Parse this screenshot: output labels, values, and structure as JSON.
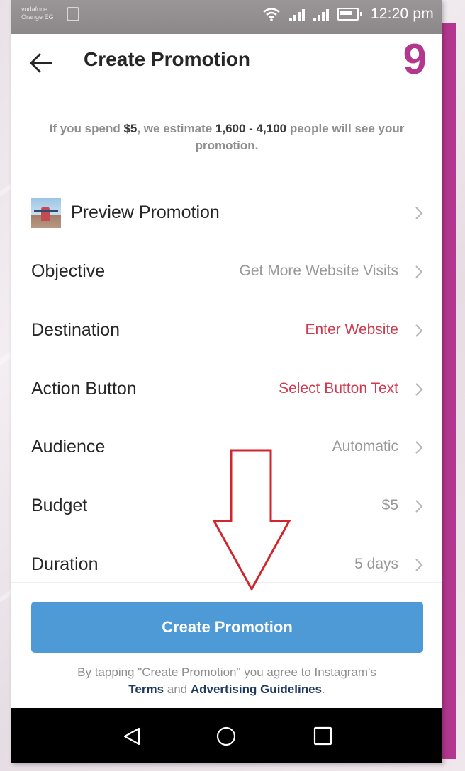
{
  "status_bar": {
    "carrier_line1": "vodafone",
    "carrier_line2": "Orange EG",
    "time": "12:20 pm"
  },
  "header": {
    "title": "Create Promotion",
    "step_number": "9"
  },
  "estimate": {
    "prefix": "If you spend ",
    "spend": "$5",
    "middle": ", we estimate ",
    "range": "1,600 - 4,100",
    "suffix": " people will see your promotion."
  },
  "rows": [
    {
      "label": "Preview Promotion",
      "value": ""
    },
    {
      "label": "Objective",
      "value": "Get More Website Visits"
    },
    {
      "label": "Destination",
      "value": "Enter Website"
    },
    {
      "label": "Action Button",
      "value": "Select Button Text"
    },
    {
      "label": "Audience",
      "value": "Automatic"
    },
    {
      "label": "Budget",
      "value": "$5"
    },
    {
      "label": "Duration",
      "value": "5 days"
    }
  ],
  "cta": {
    "label": "Create Promotion"
  },
  "legal": {
    "text": "By tapping \"Create Promotion\" you agree to Instagram's",
    "terms": "Terms",
    "and": " and ",
    "guidelines": "Advertising Guidelines",
    "period": "."
  },
  "colors": {
    "accent_magenta": "#b3368f",
    "link_red": "#d33a4e",
    "button_blue": "#4d9ad6",
    "annotation_red": "#d1262b"
  },
  "icons": {
    "back": "back-arrow-icon",
    "chevron": "chevron-right-icon",
    "nav_back": "triangle-back-icon",
    "nav_home": "circle-home-icon",
    "nav_recents": "square-recents-icon"
  }
}
